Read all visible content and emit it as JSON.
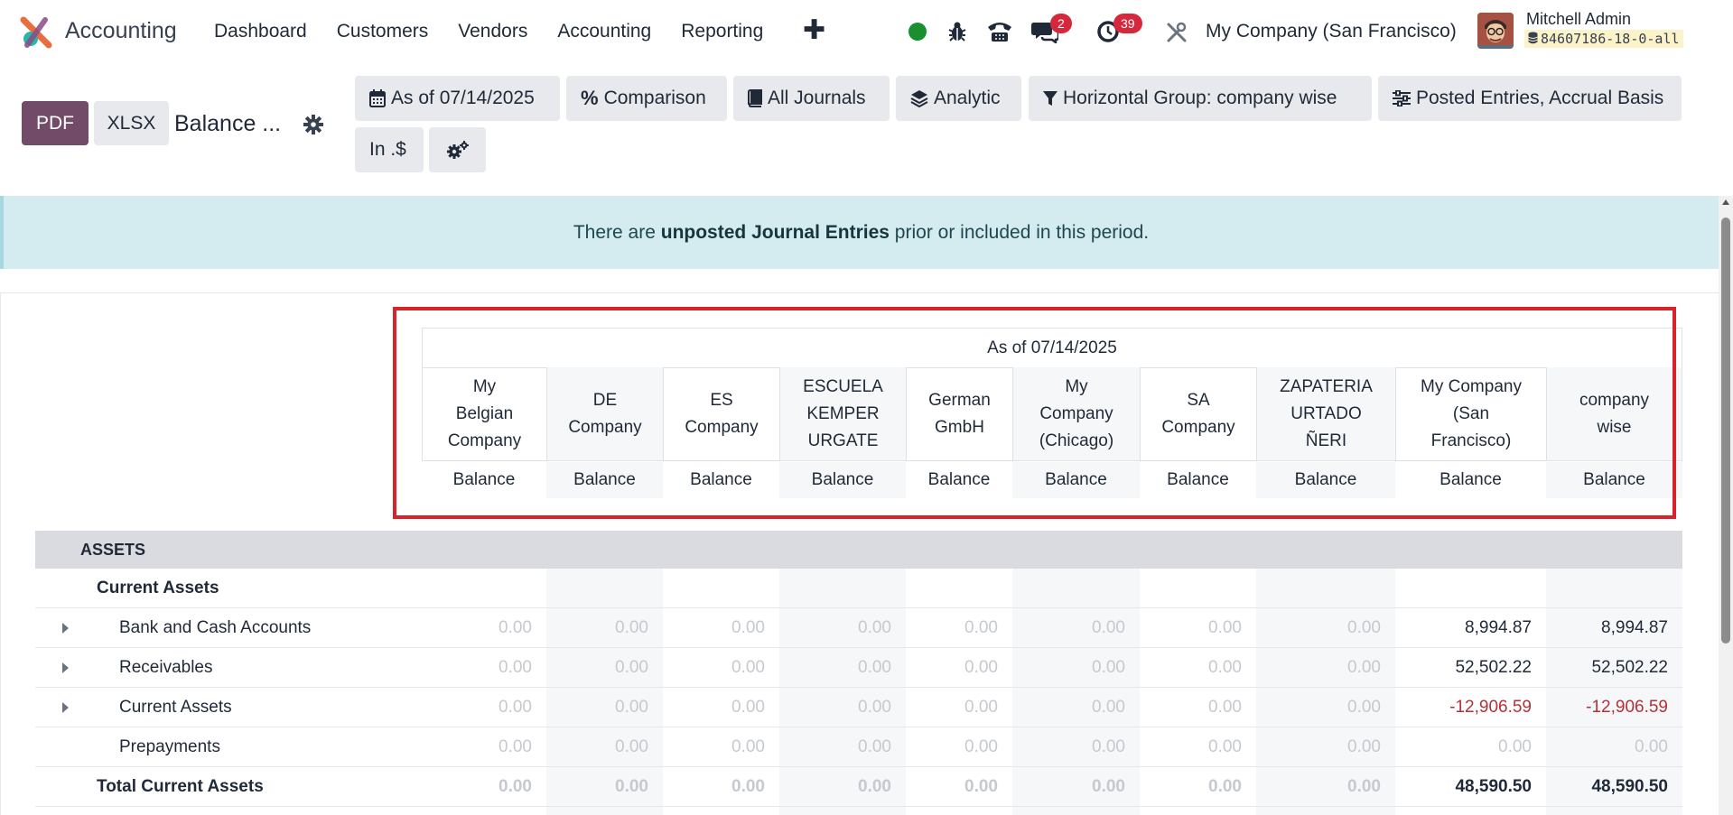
{
  "navbar": {
    "app_name": "Accounting",
    "menu": [
      "Dashboard",
      "Customers",
      "Vendors",
      "Accounting",
      "Reporting"
    ],
    "chat_badge": "2",
    "activity_badge": "39",
    "company": "My Company (San Francisco)",
    "user_name": "Mitchell Admin",
    "db_name": "84607186-18-0-all"
  },
  "control": {
    "pdf_label": "PDF",
    "xlsx_label": "XLSX",
    "title": "Balance ...",
    "filters": {
      "date": "As of 07/14/2025",
      "comparison": "Comparison",
      "journals": "All Journals",
      "analytic": "Analytic",
      "horizontal_group": "Horizontal Group: company wise",
      "entries": "Posted Entries, Accrual Basis",
      "currency": "In .$"
    }
  },
  "alert": {
    "prefix": "There are ",
    "bold": "unposted Journal Entries",
    "suffix": " prior or included in this period."
  },
  "report": {
    "period_header": "As of 07/14/2025",
    "columns": [
      "My\nBelgian\nCompany",
      "DE\nCompany",
      "ES\nCompany",
      "ESCUELA\nKEMPER\nURGATE",
      "German\nGmbH",
      "My\nCompany\n(Chicago)",
      "SA\nCompany",
      "ZAPATERIA\nURTADO\nÑERI",
      "My Company\n(San\nFrancisco)",
      "company\nwise"
    ],
    "subheader": "Balance",
    "section": "ASSETS",
    "subsection": "Current Assets",
    "rows": [
      {
        "label": "Bank and Cash Accounts",
        "values": [
          "0.00",
          "0.00",
          "0.00",
          "0.00",
          "0.00",
          "0.00",
          "0.00",
          "0.00",
          "8,994.87",
          "8,994.87"
        ]
      },
      {
        "label": "Receivables",
        "values": [
          "0.00",
          "0.00",
          "0.00",
          "0.00",
          "0.00",
          "0.00",
          "0.00",
          "0.00",
          "52,502.22",
          "52,502.22"
        ]
      },
      {
        "label": "Current Assets",
        "values": [
          "0.00",
          "0.00",
          "0.00",
          "0.00",
          "0.00",
          "0.00",
          "0.00",
          "0.00",
          "-12,906.59",
          "-12,906.59"
        ]
      },
      {
        "label": "Prepayments",
        "values": [
          "0.00",
          "0.00",
          "0.00",
          "0.00",
          "0.00",
          "0.00",
          "0.00",
          "0.00",
          "0.00",
          "0.00"
        ]
      }
    ],
    "total": {
      "label": "Total Current Assets",
      "values": [
        "0.00",
        "0.00",
        "0.00",
        "0.00",
        "0.00",
        "0.00",
        "0.00",
        "0.00",
        "48,590.50",
        "48,590.50"
      ]
    }
  }
}
